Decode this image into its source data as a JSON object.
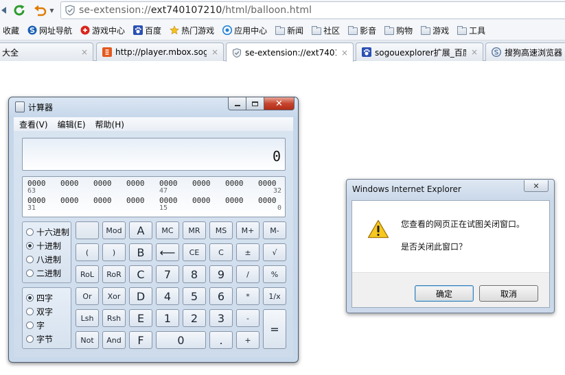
{
  "browser": {
    "url_prefix": "se-extension://",
    "url_host": "ext740107210",
    "url_path": "/html/balloon.html",
    "bookmarks": [
      "收藏",
      "网址导航",
      "游戏中心",
      "百度",
      "热门游戏",
      "应用中心",
      "新闻",
      "社区",
      "影音",
      "购物",
      "游戏",
      "工具"
    ],
    "tabs": [
      {
        "label": "大全",
        "active": false
      },
      {
        "label": "http://player.mbox.sog",
        "active": false
      },
      {
        "label": "se-extension://ext7401",
        "active": true
      },
      {
        "label": "sogouexplorer扩展_百度",
        "active": false
      },
      {
        "label": "搜狗高速浏览器 -",
        "active": false
      }
    ],
    "tab_close": "×"
  },
  "calculator": {
    "title": "计算器",
    "menu": [
      "查看(V)",
      "编辑(E)",
      "帮助(H)"
    ],
    "display": "0",
    "bits_row1": [
      "0000",
      "0000",
      "0000",
      "0000",
      "0000",
      "0000",
      "0000",
      "0000"
    ],
    "bits_row1_labels": [
      "63",
      "47",
      "32"
    ],
    "bits_row2": [
      "0000",
      "0000",
      "0000",
      "0000",
      "0000",
      "0000",
      "0000",
      "0000"
    ],
    "bits_row2_labels": [
      "31",
      "15",
      "0"
    ],
    "base_modes": [
      "十六进制",
      "十进制",
      "八进制",
      "二进制"
    ],
    "base_selected": "十进制",
    "word_modes": [
      "四字",
      "双字",
      "字",
      "字节"
    ],
    "word_selected": "四字",
    "keys": {
      "mod": "Mod",
      "a": "A",
      "mc": "MC",
      "mr": "MR",
      "ms": "MS",
      "mplus": "M+",
      "mminus": "M-",
      "lparen": "(",
      "rparen": ")",
      "b": "B",
      "back": "⟵",
      "ce": "CE",
      "c": "C",
      "plusminus": "±",
      "sqrt": "√",
      "rol": "RoL",
      "ror": "RoR",
      "cc": "C",
      "seven": "7",
      "eight": "8",
      "nine": "9",
      "div": "/",
      "pct": "%",
      "or": "Or",
      "xor": "Xor",
      "d": "D",
      "four": "4",
      "five": "5",
      "six": "6",
      "mul": "*",
      "recip": "1/x",
      "lsh": "Lsh",
      "rsh": "Rsh",
      "e": "E",
      "one": "1",
      "two": "2",
      "three": "3",
      "minus": "-",
      "eq": "=",
      "not": "Not",
      "and": "And",
      "f": "F",
      "zero": "0",
      "dot": ".",
      "plus": "+"
    }
  },
  "dialog": {
    "title": "Windows Internet Explorer",
    "message1": "您查看的网页正在试图关闭窗口。",
    "message2": "是否关闭此窗口？",
    "ok": "确定",
    "cancel": "取消"
  }
}
